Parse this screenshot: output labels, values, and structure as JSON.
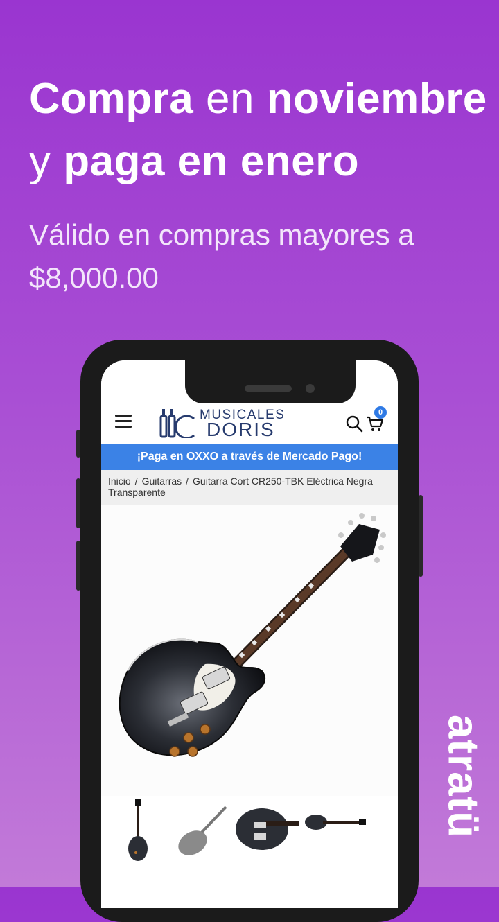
{
  "ad": {
    "headline_line1_bold_a": "Compra",
    "headline_line1_thin": "en",
    "headline_line1_bold_b": "noviembre",
    "headline_line2_thin": "y",
    "headline_line2_bold": "paga en enero",
    "subline": "Válido en compras mayores a $8,000.00",
    "brand": "atratü"
  },
  "site": {
    "logo_top": "MUSICALES",
    "logo_bottom": "DORIS",
    "cart_count": "0",
    "promo_banner": "¡Paga en OXXO a través de Mercado Pago!",
    "breadcrumb": {
      "home": "Inicio",
      "category": "Guitarras",
      "current": "Guitarra Cort CR250-TBK Eléctrica Negra Transparente"
    },
    "thumbnail_count": 4
  },
  "colors": {
    "background_top": "#9a35d0",
    "background_bottom": "#c27ad8",
    "promo_blue": "#3b82e6",
    "logo_navy": "#273b6e"
  },
  "icons": [
    "menu-icon",
    "search-icon",
    "cart-icon"
  ]
}
